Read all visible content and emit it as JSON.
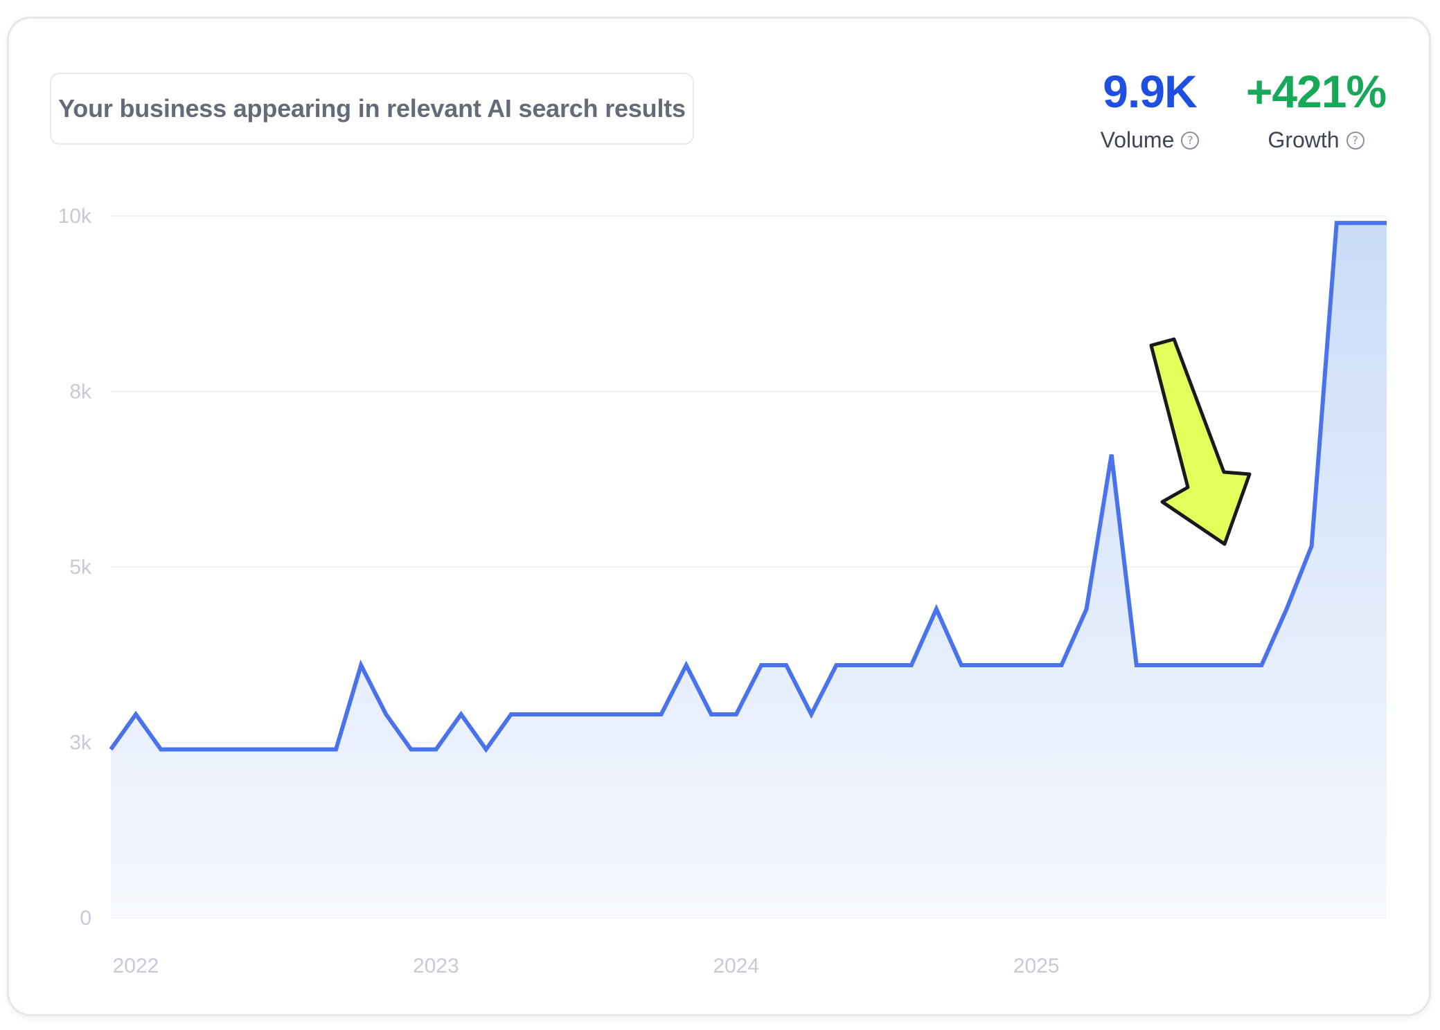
{
  "header": {
    "title": "Your business appearing in relevant AI search results"
  },
  "metrics": {
    "volume": {
      "value": "9.9K",
      "label": "Volume",
      "color": "#1f4fe0",
      "help_icon": "question-circle-icon"
    },
    "growth": {
      "value": "+421%",
      "label": "Growth",
      "color": "#17a85a",
      "help_icon": "question-circle-icon"
    }
  },
  "annotation": {
    "icon": "arrow-down-icon",
    "color": "#e4ff5c"
  },
  "chart_data": {
    "type": "area",
    "x_start": "2022-01",
    "x": [
      "2022-01",
      "2022-02",
      "2022-03",
      "2022-04",
      "2022-05",
      "2022-06",
      "2022-07",
      "2022-08",
      "2022-09",
      "2022-10",
      "2022-11",
      "2022-12",
      "2023-01",
      "2023-02",
      "2023-03",
      "2023-04",
      "2023-05",
      "2023-06",
      "2023-07",
      "2023-08",
      "2023-09",
      "2023-10",
      "2023-11",
      "2023-12",
      "2024-01",
      "2024-02",
      "2024-03",
      "2024-04",
      "2024-05",
      "2024-06",
      "2024-07",
      "2024-08",
      "2024-09",
      "2024-10",
      "2024-11",
      "2024-12",
      "2025-01",
      "2025-02",
      "2025-03",
      "2025-04",
      "2025-05",
      "2025-06",
      "2025-07",
      "2025-08",
      "2025-09",
      "2025-10",
      "2025-11",
      "2025-12"
    ],
    "series": [
      {
        "values": [
          2400,
          2900,
          2400,
          2400,
          2400,
          2400,
          2400,
          2400,
          2400,
          2400,
          3600,
          2900,
          2400,
          2400,
          2900,
          2400,
          2900,
          2900,
          2900,
          2900,
          2900,
          2900,
          2900,
          3600,
          2900,
          2900,
          3600,
          3600,
          2900,
          3600,
          3600,
          3600,
          3600,
          4400,
          3600,
          3600,
          3600,
          3600,
          3600,
          4400,
          6600,
          3600,
          3600,
          3600,
          3600,
          3600,
          3600,
          4400,
          5300,
          9900,
          9900,
          9900
        ],
        "color": "#4a72ea"
      }
    ],
    "x_tick_labels": [
      "2022",
      "2023",
      "2024",
      "2025"
    ],
    "y_tick_labels": [
      "0",
      "3k",
      "5k",
      "8k",
      "10k"
    ],
    "ylim": [
      0,
      10000
    ],
    "grid": true,
    "legend": "none"
  }
}
